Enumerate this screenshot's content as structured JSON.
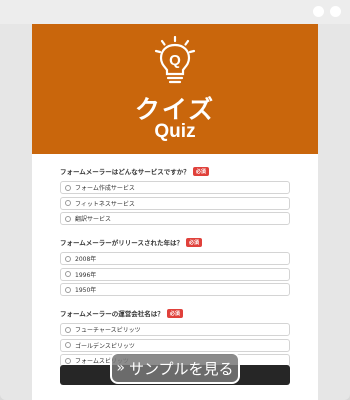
{
  "header": {
    "title_jp": "クイズ",
    "title_en": "Quiz",
    "icon": "lightbulb-q-icon",
    "bg_color": "#c9660c"
  },
  "questions": [
    {
      "label": "フォームメーラーはどんなサービスですか？",
      "badge": "必須",
      "options": [
        "フォーム作成サービス",
        "フィットネスサービス",
        "翻訳サービス"
      ]
    },
    {
      "label": "フォームメーラーがリリースされた年は？",
      "badge": "必須",
      "options": [
        "2008年",
        "1996年",
        "1950年"
      ]
    },
    {
      "label": "フォームメーラーの運営会社名は？",
      "badge": "必須",
      "options": [
        "フューチャースピリッツ",
        "ゴールデンスピリッツ",
        "フォームスピリッツ"
      ]
    }
  ],
  "sample_button": {
    "label": "サンプルを見る",
    "icon": "double-chevron-right-icon"
  }
}
